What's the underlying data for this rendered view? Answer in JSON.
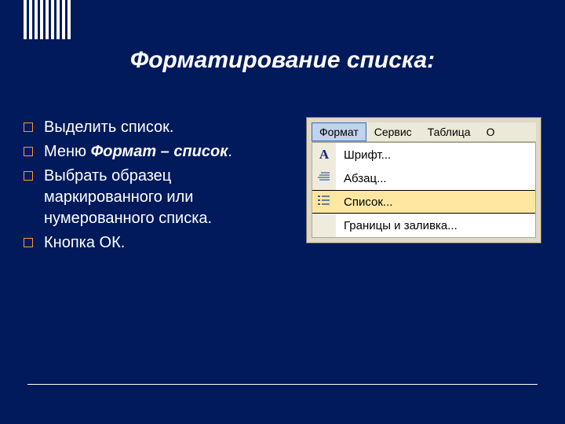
{
  "title": "Форматирование списка:",
  "steps": [
    {
      "prefix": "",
      "bold_italic": "",
      "main": "Выделить список."
    },
    {
      "prefix": "Меню ",
      "bold_italic": "Формат – список",
      "main": "."
    },
    {
      "prefix": "",
      "bold_italic": "",
      "main": "Выбрать образец маркированного или нумерованного списка."
    },
    {
      "prefix": "",
      "bold_italic": "",
      "main": "Кнопка ОК."
    }
  ],
  "menubar": {
    "items": [
      "Формат",
      "Сервис",
      "Таблица",
      "О"
    ]
  },
  "dropdown": {
    "items": [
      {
        "icon": "font-icon",
        "label": "Шрифт...",
        "highlight": false
      },
      {
        "icon": "paragraph-icon",
        "label": "Абзац...",
        "highlight": false
      },
      {
        "icon": "list-icon",
        "label": "Список...",
        "highlight": true
      },
      {
        "icon": "",
        "label": "Границы и заливка...",
        "highlight": false
      }
    ]
  }
}
